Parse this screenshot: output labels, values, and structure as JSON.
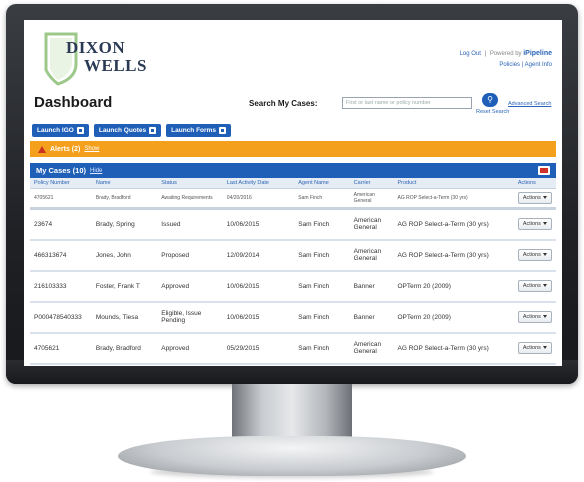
{
  "brand": {
    "line1": "DIXON",
    "line2": "WELLS"
  },
  "top_links": {
    "logout": "Log Out",
    "sep": "|",
    "powered": "Powered by",
    "ipipeline": "iPipeline",
    "policies": "Policies",
    "agent_info": "Agent Info"
  },
  "page_title": "Dashboard",
  "search": {
    "label": "Search My Cases:",
    "placeholder": "First or last name or policy number",
    "reset": "Reset Search",
    "advanced": "Advanced Search"
  },
  "launch_buttons": [
    "Launch IGO",
    "Launch Quotes",
    "Launch Forms"
  ],
  "alerts": {
    "label": "Alerts (2)",
    "show": "Show"
  },
  "cases": {
    "title": "My Cases (10)",
    "hide": "Hide",
    "columns": [
      "Policy Number",
      "Name",
      "Status",
      "Last Activity Date",
      "Agent Name",
      "Carrier",
      "Product",
      "Actions"
    ],
    "rows": [
      {
        "policy": "4705621",
        "name": "Brady, Bradford",
        "status": "Awaiting Requirements",
        "date": "04/20/2016",
        "agent": "Sam Finch",
        "carrier": "American General",
        "product": "AG ROP Select-a-Term (30 yrs)",
        "action": "Actions"
      },
      {
        "policy": "23674",
        "name": "Brady, Spring",
        "status": "Issued",
        "date": "10/06/2015",
        "agent": "Sam Finch",
        "carrier": "American General",
        "product": "AG ROP Select-a-Term (30 yrs)",
        "action": "Actions"
      },
      {
        "policy": "466313674",
        "name": "Jones, John",
        "status": "Proposed",
        "date": "12/09/2014",
        "agent": "Sam Finch",
        "carrier": "American General",
        "product": "AG ROP Select-a-Term (30 yrs)",
        "action": "Actions"
      },
      {
        "policy": "216103333",
        "name": "Foster, Frank T",
        "status": "Approved",
        "date": "10/06/2015",
        "agent": "Sam Finch",
        "carrier": "Banner",
        "product": "OPTerm 20 (2009)",
        "action": "Actions"
      },
      {
        "policy": "P000478540333",
        "name": "Mounds, Tiesa",
        "status": "Eligible, Issue Pending",
        "date": "10/06/2015",
        "agent": "Sam Finch",
        "carrier": "Banner",
        "product": "OPTerm 20 (2009)",
        "action": "Actions"
      },
      {
        "policy": "4705621",
        "name": "Brady, Bradford",
        "status": "Approved",
        "date": "05/29/2015",
        "agent": "Sam Finch",
        "carrier": "American General",
        "product": "AG ROP Select-a-Term (30 yrs)",
        "action": "Actions"
      }
    ]
  }
}
